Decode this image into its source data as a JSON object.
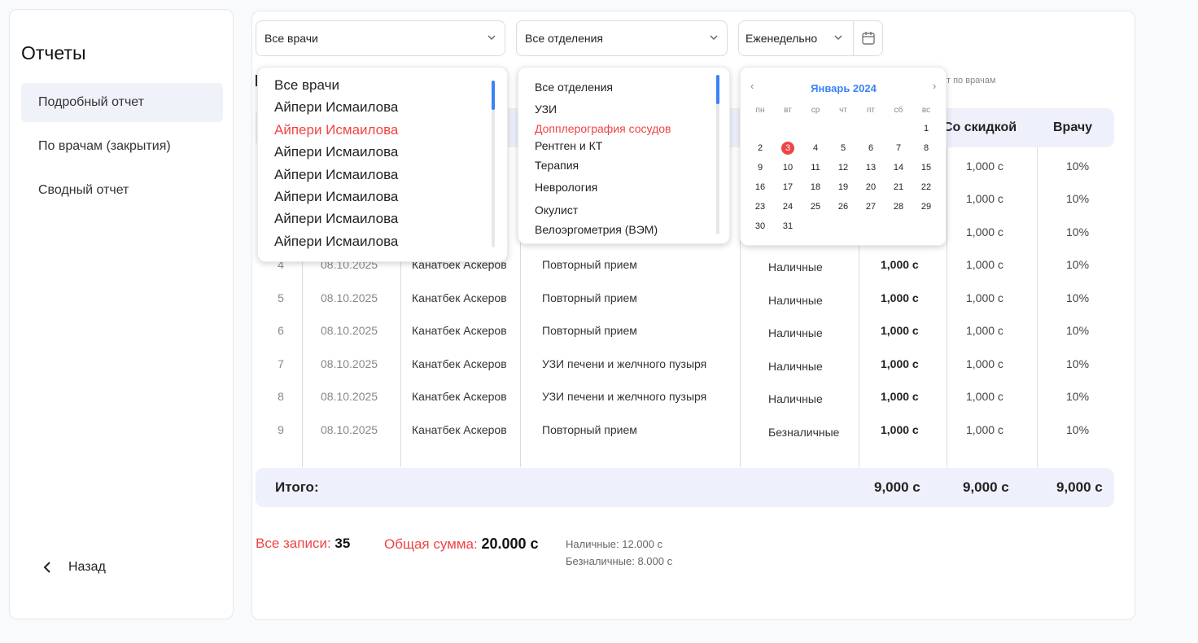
{
  "sidebar": {
    "title": "Отчеты",
    "items": [
      {
        "label": "Подробный отчет",
        "active": true
      },
      {
        "label": "По врачам (закрытия)",
        "active": false
      },
      {
        "label": "Сводный отчет",
        "active": false
      }
    ],
    "back_label": "Назад"
  },
  "filters": {
    "doctor": "Все врачи",
    "department": "Все отделения",
    "period": "Еженедельно"
  },
  "hint_text": "т по врачам",
  "table": {
    "headers": {
      "discount": "Со скидкой",
      "doctor_share": "Врачу"
    },
    "rows": [
      {
        "num": "",
        "date": "",
        "doctor": "в",
        "service": "",
        "payment": "",
        "sum": "",
        "discount": "1,000 с",
        "pct": "10%"
      },
      {
        "num": "",
        "date": "",
        "doctor": "в",
        "service": "",
        "payment": "",
        "sum": "",
        "discount": "1,000 с",
        "pct": "10%"
      },
      {
        "num": "",
        "date": "",
        "doctor": "",
        "service": "",
        "payment": "",
        "sum": "",
        "discount": "1,000 с",
        "pct": "10%"
      },
      {
        "num": "4",
        "date": "08.10.2025",
        "doctor": "Канатбек Аскеров",
        "service": "Повторный прием",
        "payment": "Наличные",
        "sum": "1,000 с",
        "discount": "1,000 с",
        "pct": "10%"
      },
      {
        "num": "5",
        "date": "08.10.2025",
        "doctor": "Канатбек Аскеров",
        "service": "Повторный прием",
        "payment": "Наличные",
        "sum": "1,000 с",
        "discount": "1,000 с",
        "pct": "10%"
      },
      {
        "num": "6",
        "date": "08.10.2025",
        "doctor": "Канатбек Аскеров",
        "service": "Повторный прием",
        "payment": "Наличные",
        "sum": "1,000 с",
        "discount": "1,000 с",
        "pct": "10%"
      },
      {
        "num": "7",
        "date": "08.10.2025",
        "doctor": "Канатбек Аскеров",
        "service": "УЗИ печени и желчного пузыря",
        "payment": "Наличные",
        "sum": "1,000 с",
        "discount": "1,000 с",
        "pct": "10%"
      },
      {
        "num": "8",
        "date": "08.10.2025",
        "doctor": "Канатбек Аскеров",
        "service": "УЗИ печени и желчного пузыря",
        "payment": "Наличные",
        "sum": "1,000 с",
        "discount": "1,000 с",
        "pct": "10%"
      },
      {
        "num": "9",
        "date": "08.10.2025",
        "doctor": "Канатбек Аскеров",
        "service": "Повторный прием",
        "payment": "Безналичные",
        "sum": "1,000 с",
        "discount": "1,000 с",
        "pct": "10%"
      }
    ],
    "footer": {
      "label": "Итого:",
      "sum": "9,000 с",
      "discount": "9,000 с",
      "doctor_share": "9,000 с"
    }
  },
  "summary": {
    "records_label": "Все записи:",
    "records_value": "35",
    "total_label": "Общая сумма:",
    "total_value": "20.000 с",
    "cash": "Наличные: 12.000 с",
    "cashless": "Безналичные: 8.000 с"
  },
  "doctor_dropdown": {
    "items": [
      {
        "label": "Все врачи",
        "highlighted": false
      },
      {
        "label": "Айпери Исмаилова",
        "highlighted": false
      },
      {
        "label": "Айпери Исмаилова",
        "highlighted": true
      },
      {
        "label": "Айпери Исмаилова",
        "highlighted": false
      },
      {
        "label": "Айпери Исмаилова",
        "highlighted": false
      },
      {
        "label": "Айпери Исмаилова",
        "highlighted": false
      },
      {
        "label": "Айпери Исмаилова",
        "highlighted": false
      },
      {
        "label": "Айпери Исмаилова",
        "highlighted": false
      }
    ]
  },
  "department_dropdown": {
    "items": [
      {
        "label": "Все отделения",
        "highlighted": false
      },
      {
        "label": "УЗИ",
        "highlighted": false
      },
      {
        "label": "Допплерография сосудов",
        "highlighted": true
      },
      {
        "label": "Рентген и КТ",
        "highlighted": false
      },
      {
        "label": "Терапия",
        "highlighted": false
      },
      {
        "label": "Неврология",
        "highlighted": false
      },
      {
        "label": "Окулист",
        "highlighted": false
      },
      {
        "label": "Велоэргометрия (ВЭМ)",
        "highlighted": false
      }
    ]
  },
  "calendar": {
    "month_label": "Январь 2024",
    "prev": "‹",
    "next": "›",
    "weekdays": [
      "пн",
      "вт",
      "ср",
      "чт",
      "пт",
      "сб",
      "вс"
    ],
    "weeks": [
      [
        "",
        "",
        "",
        "",
        "",
        "",
        "1"
      ],
      [
        "2",
        "3",
        "4",
        "5",
        "6",
        "7",
        "8"
      ],
      [
        "9",
        "10",
        "11",
        "12",
        "13",
        "14",
        "15"
      ],
      [
        "16",
        "17",
        "18",
        "19",
        "20",
        "21",
        "22"
      ],
      [
        "23",
        "24",
        "25",
        "26",
        "27",
        "28",
        "29"
      ],
      [
        "30",
        "31",
        "",
        "",
        "",
        "",
        ""
      ]
    ],
    "selected_day": "3"
  },
  "colors": {
    "accent": "#3b82f6",
    "danger": "#f04444",
    "header_bg": "#eef0fb"
  },
  "icons": {
    "calendar": "calendar-icon",
    "chevron": "chevron-down-icon",
    "back": "chevron-left-icon"
  }
}
